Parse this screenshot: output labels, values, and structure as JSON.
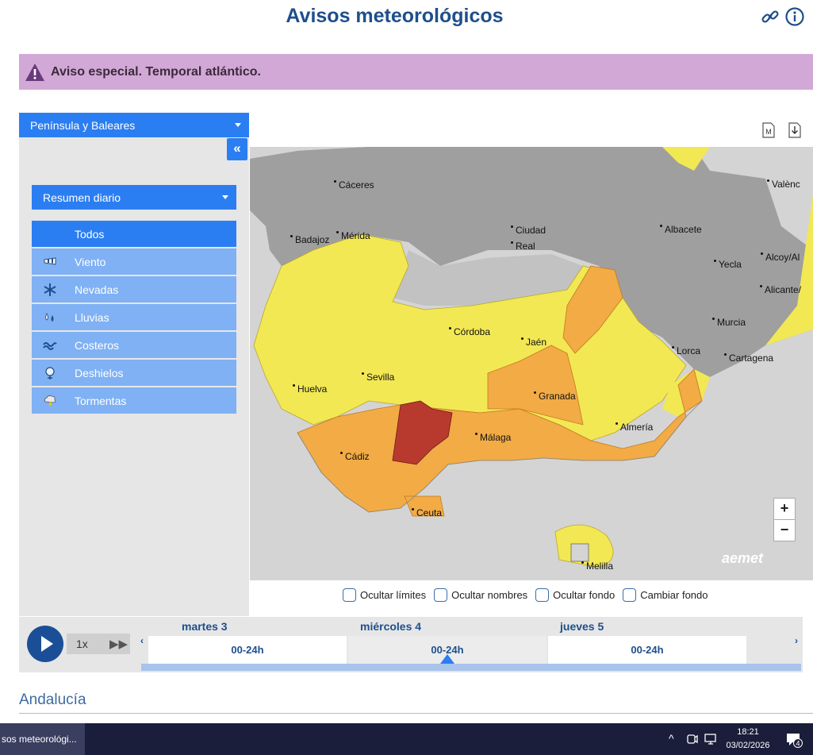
{
  "header": {
    "title": "Avisos meteorológicos",
    "icons": [
      "link-icon",
      "info-icon"
    ]
  },
  "banner": {
    "text": "Aviso especial. Temporal atlántico.",
    "icon": "warning-triangle-icon"
  },
  "sidebar": {
    "region": "Península y Baleares",
    "collapse_label": "«",
    "summary": "Resumen diario",
    "filters": [
      {
        "label": "Todos",
        "icon": "",
        "active": true
      },
      {
        "label": "Viento",
        "icon": "wind-icon"
      },
      {
        "label": "Nevadas",
        "icon": "snowflake-icon"
      },
      {
        "label": "Lluvias",
        "icon": "rain-icon"
      },
      {
        "label": "Costeros",
        "icon": "waves-icon"
      },
      {
        "label": "Deshielos",
        "icon": "thaw-icon"
      },
      {
        "label": "Tormentas",
        "icon": "storm-icon"
      }
    ]
  },
  "map": {
    "tools": [
      "map-mode-icon",
      "download-icon"
    ],
    "cities": [
      "Cáceres",
      "Badajoz",
      "Mérida",
      "Ciudad",
      "Real",
      "Albacete",
      "Valènc",
      "Yecla",
      "Alcoy/Al",
      "Alicante/",
      "Murcia",
      "Lorca",
      "Cartagena",
      "Córdoba",
      "Jaén",
      "Sevilla",
      "Huelva",
      "Granada",
      "Almería",
      "Málaga",
      "Cádiz",
      "Ceuta",
      "Melilla"
    ],
    "zoom_in": "+",
    "zoom_out": "−",
    "brand": "aemet",
    "colors": {
      "yellow": "#f2e854",
      "orange": "#f2ab45",
      "red": "#b83a2e",
      "gray": "#9c9c9c"
    }
  },
  "options": [
    "Ocultar límites",
    "Ocultar nombres",
    "Ocultar fondo",
    "Cambiar fondo"
  ],
  "player": {
    "speed": "1x",
    "forward": "▶▶"
  },
  "timeline": {
    "prev": "‹",
    "next": "›",
    "days": [
      {
        "name": "martes 3",
        "slot": "00-24h"
      },
      {
        "name": "miércoles 4",
        "slot": "00-24h"
      },
      {
        "name": "jueves 5",
        "slot": "00-24h"
      }
    ]
  },
  "area": {
    "title": "Andalucía"
  },
  "taskbar": {
    "app": "sos meteorológi...",
    "time": "18:21",
    "date": "03/02/2026",
    "badge": "4"
  }
}
